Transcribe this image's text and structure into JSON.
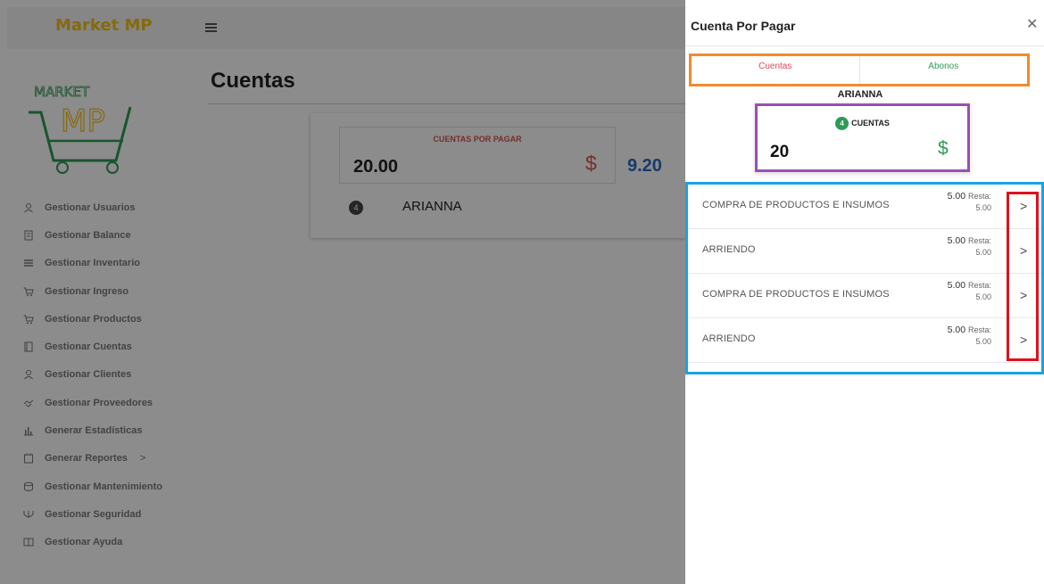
{
  "app": {
    "brand": "Market MP",
    "logo_text_top": "MARKET",
    "logo_text_bottom": "MP"
  },
  "sidebar": {
    "items": [
      {
        "label": "Gestionar Usuarios",
        "icon": "user-icon"
      },
      {
        "label": "Gestionar Balance",
        "icon": "ledger-icon"
      },
      {
        "label": "Gestionar Inventario",
        "icon": "inventory-icon"
      },
      {
        "label": "Gestionar Ingreso",
        "icon": "cart-icon"
      },
      {
        "label": "Gestionar Productos",
        "icon": "cart-icon"
      },
      {
        "label": "Gestionar Cuentas",
        "icon": "book-icon"
      },
      {
        "label": "Gestionar Clientes",
        "icon": "user-icon"
      },
      {
        "label": "Gestionar Proveedores",
        "icon": "handshake-icon"
      },
      {
        "label": "Generar Estadísticas",
        "icon": "bar-chart-icon"
      },
      {
        "label": "Generar Reportes",
        "icon": "calendar-icon"
      },
      {
        "label": "Gestionar Mantenimiento",
        "icon": "database-icon"
      },
      {
        "label": "Gestionar Seguridad",
        "icon": "shield-icon"
      },
      {
        "label": "Gestionar Ayuda",
        "icon": "help-book-icon"
      }
    ]
  },
  "main": {
    "title": "Cuentas",
    "card": {
      "stat1_label": "CUENTAS POR PAGAR",
      "stat1_value": "20.00",
      "stat1_sign": "$",
      "stat2_value": "9.20",
      "row_badge": "4",
      "row_name": "ARIANNA"
    }
  },
  "drawer": {
    "title": "Cuenta Por Pagar",
    "tabs": [
      "Cuentas",
      "Abonos"
    ],
    "supplier": "ARIANNA",
    "summary": {
      "badge": "4",
      "label": "CUENTAS",
      "value": "20",
      "sign": "$"
    },
    "items": [
      {
        "desc": "COMPRA DE PRODUCTOS E INSUMOS",
        "amount": "5.00",
        "rest_label": "Resta:",
        "rest": "5.00"
      },
      {
        "desc": "ARRIENDO",
        "amount": "5.00",
        "rest_label": "Resta:",
        "rest": "5.00"
      },
      {
        "desc": "COMPRA DE PRODUCTOS E INSUMOS",
        "amount": "5.00",
        "rest_label": "Resta:",
        "rest": "5.00"
      },
      {
        "desc": "ARRIENDO",
        "amount": "5.00",
        "rest_label": "Resta:",
        "rest": "5.00"
      }
    ]
  },
  "colors": {
    "brand": "#f2c21a",
    "accent_red": "#d9534f",
    "accent_green": "#2e9a55",
    "accent_blue": "#2d6cc0"
  }
}
